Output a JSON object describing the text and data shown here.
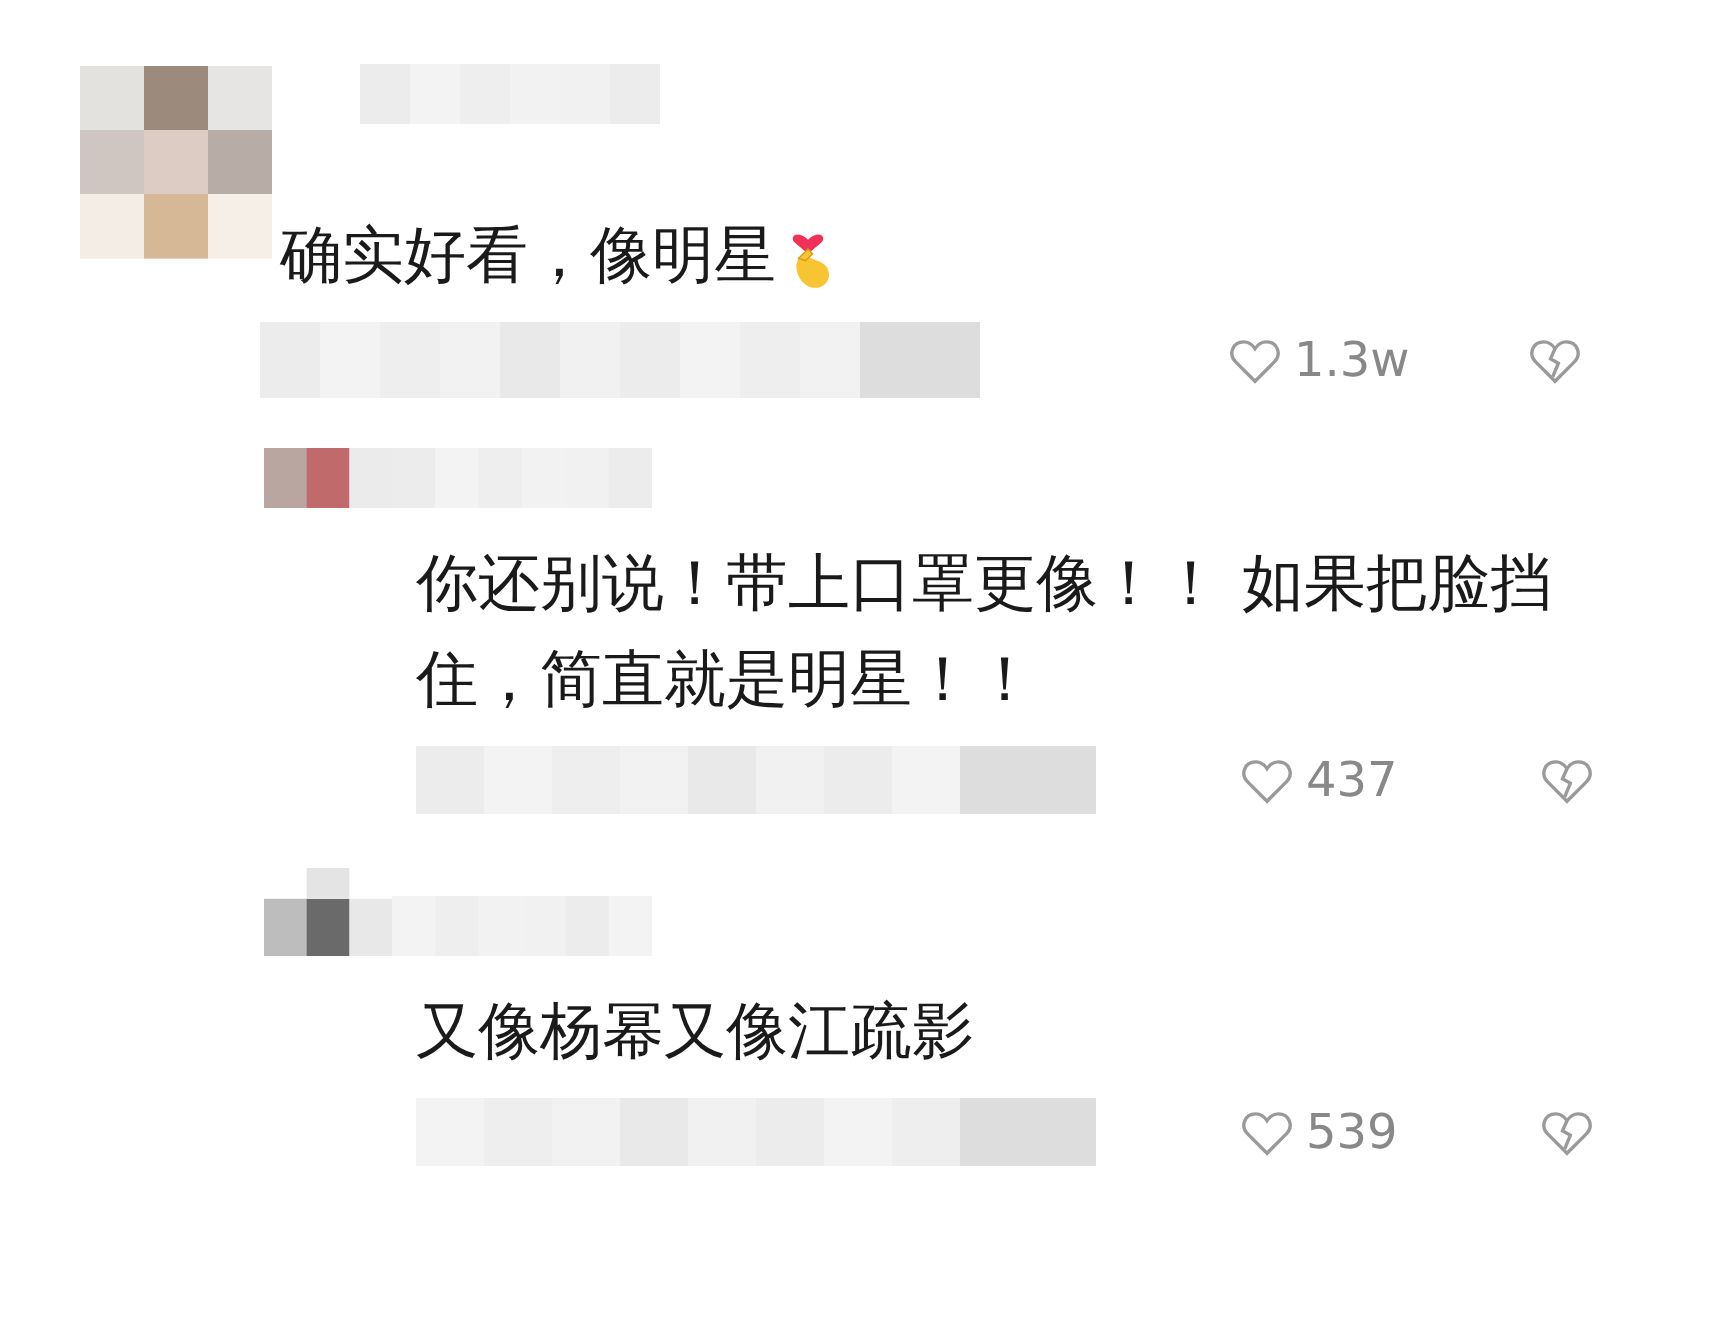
{
  "comments": [
    {
      "text": "确实好看，像明星",
      "finger_heart": true,
      "likes": "1.3w",
      "replies": [
        {
          "text": "你还别说！带上口罩更像！！ 如果把脸挡住，简直就是明星！！",
          "finger_heart": false,
          "likes": "437"
        },
        {
          "text": "又像杨幂又像江疏影",
          "finger_heart": false,
          "likes": "539"
        }
      ]
    }
  ]
}
